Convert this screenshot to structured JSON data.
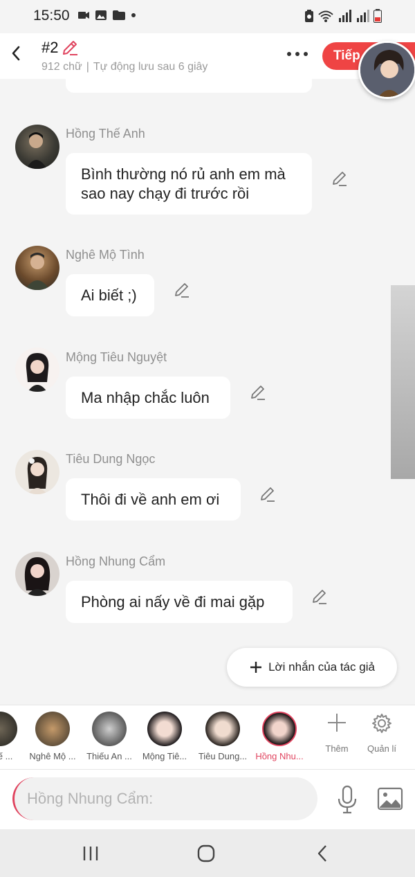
{
  "status": {
    "time": "15:50"
  },
  "header": {
    "title": "#2",
    "word_count": "912 chữ",
    "separator": "|",
    "autosave": "Tự động lưu sau 6 giây",
    "next_label": "Tiếp"
  },
  "messages": [
    {
      "name": "Hồng Thế Anh",
      "lines": [
        "Bình thường nó rủ anh em mà",
        "sao nay chạy đi trước rồi"
      ]
    },
    {
      "name": "Nghê Mộ Tình",
      "lines": [
        "Ai biết ;)"
      ]
    },
    {
      "name": "Mộng Tiêu Nguyệt",
      "lines": [
        "Ma nhập chắc luôn"
      ]
    },
    {
      "name": "Tiêu Dung Ngọc",
      "lines": [
        "Thôi đi về anh em ơi"
      ]
    },
    {
      "name": "Hồng Nhung Cẩm",
      "lines": [
        "Phòng ai nấy về đi mai gặp"
      ]
    }
  ],
  "author_note": {
    "label": "Lời nhắn của tác giả"
  },
  "characters": [
    {
      "label": "Thế ..."
    },
    {
      "label": "Nghê Mộ ..."
    },
    {
      "label": "Thiếu An ..."
    },
    {
      "label": "Mộng Tiê..."
    },
    {
      "label": "Tiêu Dung..."
    },
    {
      "label": "Hồng Nhu..."
    }
  ],
  "tools": {
    "add_label": "Thêm",
    "manage_label": "Quản lí"
  },
  "composer": {
    "placeholder": "Hồng Nhung Cẩm:"
  },
  "colors": {
    "accent": "#e0445f",
    "next_button": "#ef4444"
  }
}
